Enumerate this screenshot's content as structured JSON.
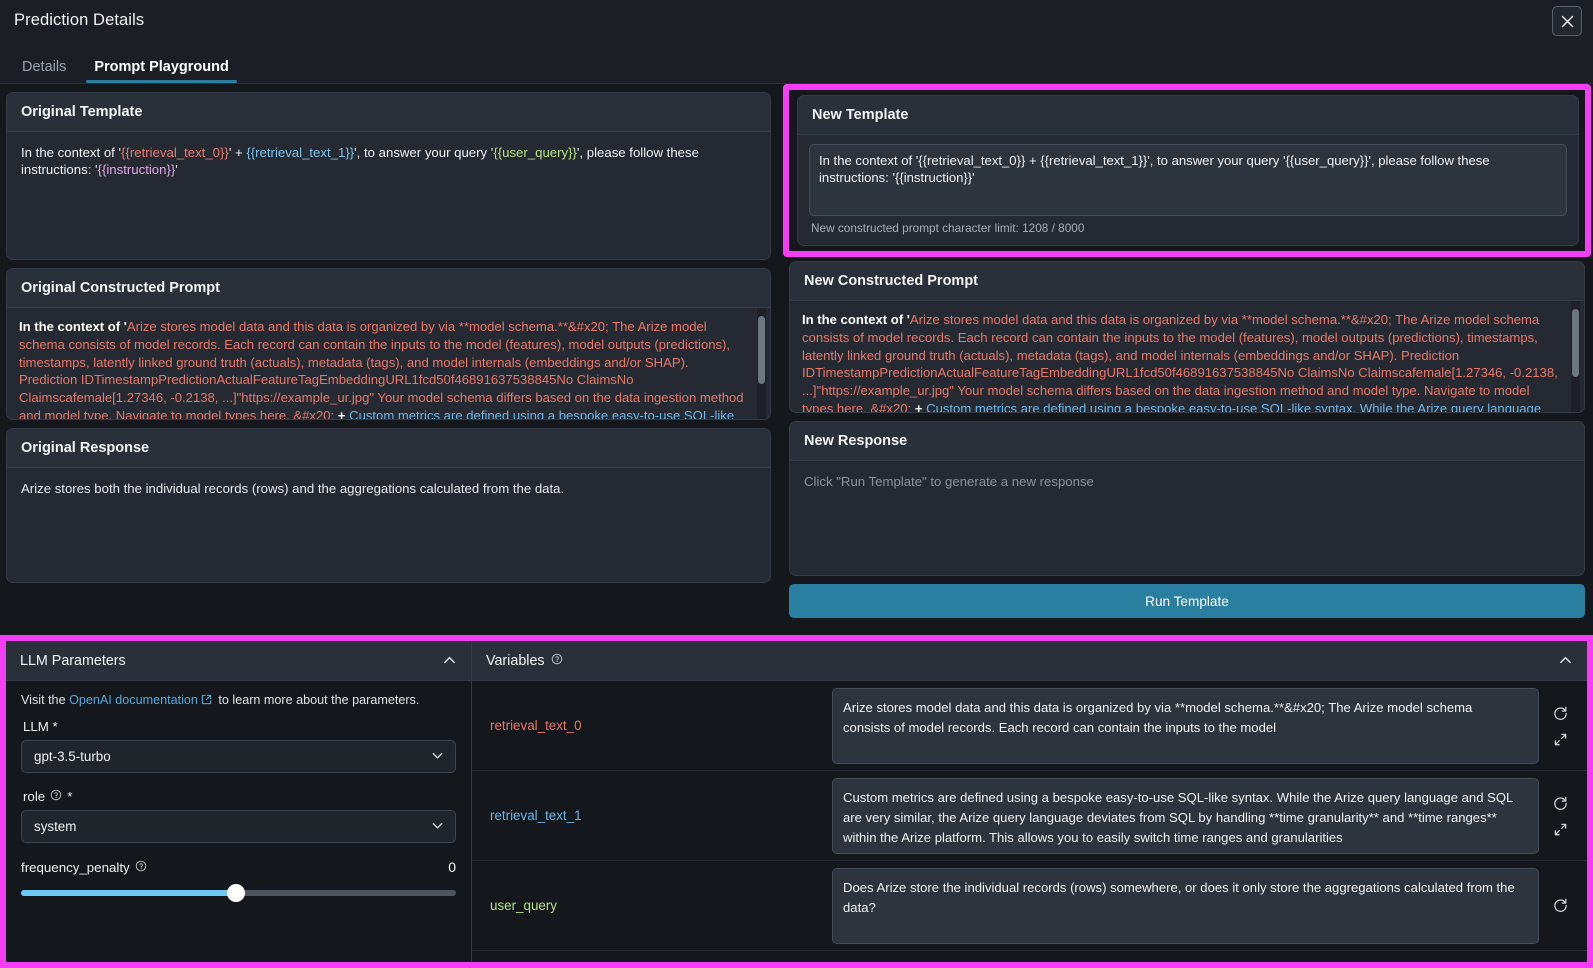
{
  "header": {
    "title": "Prediction Details",
    "close_icon": "close-icon"
  },
  "tabs": [
    {
      "label": "Details",
      "active": false
    },
    {
      "label": "Prompt Playground",
      "active": true
    }
  ],
  "original_template": {
    "title": "Original Template",
    "prefix": "In the context of '",
    "var0": "{{retrieval_text_0}}",
    "mid1": "' + ",
    "var1": "{{retrieval_text_1}}",
    "mid2": "', to answer your query '",
    "var2": "{{user_query}}",
    "mid3": "', please follow these instructions: '",
    "var3": "{{instruction}}",
    "suffix": "'"
  },
  "new_template": {
    "title": "New Template",
    "value": "In the context of '{{retrieval_text_0}} + {{retrieval_text_1}}', to answer your query '{{user_query}}', please follow these instructions: '{{instruction}}'",
    "char_limit_label": "New constructed prompt character limit: 1208 / 8000"
  },
  "original_constructed_prompt": {
    "title": "Original Constructed Prompt",
    "lead": "In the context of '",
    "segment_red": "Arize stores model data and this data is organized by via **model schema.**&#x20; The Arize model schema consists of model records. Each record can contain the inputs to the model (features), model outputs (predictions), timestamps, latently linked ground truth (actuals), metadata (tags), and model internals (embeddings and/or SHAP). Prediction IDTimestampPredictionActualFeatureTagEmbeddingURL1fcd50f46891637538845No ClaimsNo Claimscafemale[1.27346, -0.2138, ...]\"https://example_ur.jpg\" Your model schema differs based on the data ingestion method and model type. Navigate to model types here. &#x20;",
    "plus": " + ",
    "segment_blue": "Custom metrics are defined using a bespoke easy-to-use SQL-like syntax. While the Arize query language and SQL are very similar, the Arize query language deviates"
  },
  "new_constructed_prompt": {
    "title": "New Constructed Prompt",
    "lead": "In the context of '",
    "segment_red": "Arize stores model data and this data is organized by via **model schema.**&#x20; The Arize model schema consists of model records. Each record can contain the inputs to the model (features), model outputs (predictions), timestamps, latently linked ground truth (actuals), metadata (tags), and model internals (embeddings and/or SHAP). Prediction IDTimestampPredictionActualFeatureTagEmbeddingURL1fcd50f46891637538845No ClaimsNo Claimscafemale[1.27346, -0.2138, ...]\"https://example_ur.jpg\" Your model schema differs based on the data ingestion method and model type. Navigate to model types here. &#x20;",
    "plus": " + ",
    "segment_blue": "Custom metrics are defined using a bespoke easy-to-use SQL-like syntax. While the Arize query language and SQL are very similar, the Arize query language deviates"
  },
  "original_response": {
    "title": "Original Response",
    "text": "Arize stores both the individual records (rows) and the aggregations calculated from the data."
  },
  "new_response": {
    "title": "New Response",
    "placeholder": "Click \"Run Template\" to generate a new response"
  },
  "run_button": {
    "label": "Run Template"
  },
  "llm_parameters": {
    "title": "LLM Parameters",
    "collapse_icon": "chevron-up-icon",
    "hint_before": "Visit the ",
    "hint_link": "OpenAI documentation",
    "hint_link_icon": "external-link-icon",
    "hint_after": " to learn more about the parameters.",
    "llm_label": "LLM *",
    "llm_value": "gpt-3.5-turbo",
    "role_label": "role",
    "role_required": "*",
    "role_help_icon": "help-circle-icon",
    "role_value": "system",
    "frequency_penalty_label": "frequency_penalty",
    "frequency_penalty_help_icon": "help-circle-icon",
    "frequency_penalty_value": "0"
  },
  "variables": {
    "title": "Variables",
    "help_icon": "help-circle-icon",
    "collapse_icon": "chevron-up-icon",
    "rows": [
      {
        "name": "retrieval_text_0",
        "color": "#e8776b",
        "value": "Arize stores model data and this data is organized by via **model schema.**&#x20;\n\nThe Arize model schema consists of model records. Each record can contain the inputs to the model",
        "refresh_icon": "refresh-icon",
        "expand_icon": "expand-icon"
      },
      {
        "name": "retrieval_text_1",
        "color": "#6fb6e8",
        "value": "Custom metrics are defined using a bespoke easy-to-use SQL-like syntax. While the Arize query language and SQL are very similar, the Arize query language deviates from SQL by handling **time granularity** and **time ranges** within the Arize platform. This allows you to easily switch time ranges and granularities",
        "refresh_icon": "refresh-icon",
        "expand_icon": "expand-icon"
      },
      {
        "name": "user_query",
        "color": "#b8e08a",
        "value": "Does Arize store the individual records (rows) somewhere, or does it only store the aggregations calculated from the data?",
        "refresh_icon": "refresh-icon",
        "expand_icon": "expand-icon"
      }
    ]
  },
  "colors": {
    "highlight_border": "#f53df5",
    "accent": "#2a7fa0",
    "slider_fill": "#6ecbf5",
    "link": "#56a8d8"
  }
}
